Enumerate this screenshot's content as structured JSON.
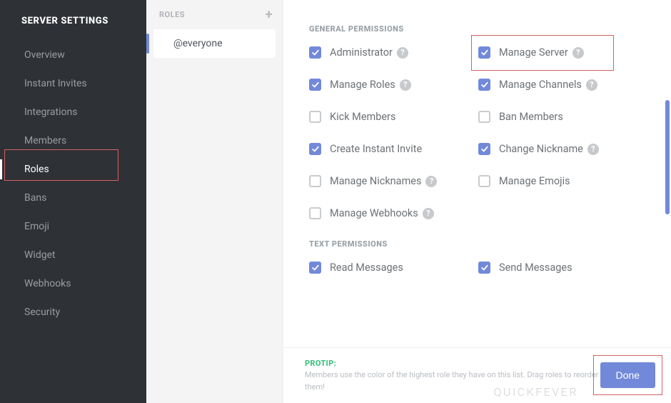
{
  "colors": {
    "accent": "#7289da",
    "highlight": "#d46161",
    "protip": "#3fbf7f"
  },
  "sidebar": {
    "title": "SERVER SETTINGS",
    "items": [
      "Overview",
      "Instant Invites",
      "Integrations",
      "Members",
      "Roles",
      "Bans",
      "Emoji",
      "Widget",
      "Webhooks",
      "Security"
    ],
    "active_index": 4
  },
  "roles_column": {
    "header": "ROLES",
    "items": [
      {
        "name": "@everyone"
      }
    ],
    "active_index": 0
  },
  "permissions": {
    "sections": [
      {
        "title": "GENERAL PERMISSIONS",
        "items": [
          {
            "label": "Administrator",
            "checked": true,
            "help": true
          },
          {
            "label": "Manage Server",
            "checked": true,
            "help": true,
            "highlight": true
          },
          {
            "label": "Manage Roles",
            "checked": true,
            "help": true
          },
          {
            "label": "Manage Channels",
            "checked": true,
            "help": true
          },
          {
            "label": "Kick Members",
            "checked": false,
            "help": false
          },
          {
            "label": "Ban Members",
            "checked": false,
            "help": false
          },
          {
            "label": "Create Instant Invite",
            "checked": true,
            "help": false
          },
          {
            "label": "Change Nickname",
            "checked": true,
            "help": true
          },
          {
            "label": "Manage Nicknames",
            "checked": false,
            "help": true
          },
          {
            "label": "Manage Emojis",
            "checked": false,
            "help": false
          },
          {
            "label": "Manage Webhooks",
            "checked": false,
            "help": true
          }
        ]
      },
      {
        "title": "TEXT PERMISSIONS",
        "items": [
          {
            "label": "Read Messages",
            "checked": true,
            "help": false
          },
          {
            "label": "Send Messages",
            "checked": true,
            "help": false
          }
        ]
      }
    ]
  },
  "footer": {
    "protip_tag": "PROTIP:",
    "protip_text": "Members use the color of the highest role they have on this list. Drag roles to reorder them!",
    "done_label": "Done"
  },
  "watermark": "QUICKFEVER"
}
